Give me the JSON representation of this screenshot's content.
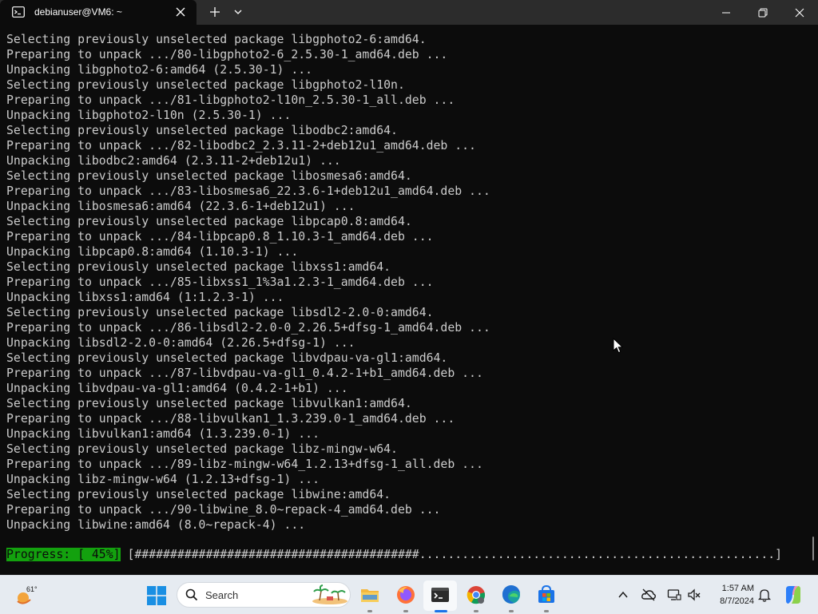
{
  "window": {
    "tab_title": "debianuser@VM6: ~",
    "icons": {
      "tab": "terminal-icon",
      "close_tab": "close-icon",
      "new_tab": "plus-icon",
      "tab_menu": "chevron-down-icon"
    }
  },
  "terminal": {
    "lines": [
      "Selecting previously unselected package libgphoto2-6:amd64.",
      "Preparing to unpack .../80-libgphoto2-6_2.5.30-1_amd64.deb ...",
      "Unpacking libgphoto2-6:amd64 (2.5.30-1) ...",
      "Selecting previously unselected package libgphoto2-l10n.",
      "Preparing to unpack .../81-libgphoto2-l10n_2.5.30-1_all.deb ...",
      "Unpacking libgphoto2-l10n (2.5.30-1) ...",
      "Selecting previously unselected package libodbc2:amd64.",
      "Preparing to unpack .../82-libodbc2_2.3.11-2+deb12u1_amd64.deb ...",
      "Unpacking libodbc2:amd64 (2.3.11-2+deb12u1) ...",
      "Selecting previously unselected package libosmesa6:amd64.",
      "Preparing to unpack .../83-libosmesa6_22.3.6-1+deb12u1_amd64.deb ...",
      "Unpacking libosmesa6:amd64 (22.3.6-1+deb12u1) ...",
      "Selecting previously unselected package libpcap0.8:amd64.",
      "Preparing to unpack .../84-libpcap0.8_1.10.3-1_amd64.deb ...",
      "Unpacking libpcap0.8:amd64 (1.10.3-1) ...",
      "Selecting previously unselected package libxss1:amd64.",
      "Preparing to unpack .../85-libxss1_1%3a1.2.3-1_amd64.deb ...",
      "Unpacking libxss1:amd64 (1:1.2.3-1) ...",
      "Selecting previously unselected package libsdl2-2.0-0:amd64.",
      "Preparing to unpack .../86-libsdl2-2.0-0_2.26.5+dfsg-1_amd64.deb ...",
      "Unpacking libsdl2-2.0-0:amd64 (2.26.5+dfsg-1) ...",
      "Selecting previously unselected package libvdpau-va-gl1:amd64.",
      "Preparing to unpack .../87-libvdpau-va-gl1_0.4.2-1+b1_amd64.deb ...",
      "Unpacking libvdpau-va-gl1:amd64 (0.4.2-1+b1) ...",
      "Selecting previously unselected package libvulkan1:amd64.",
      "Preparing to unpack .../88-libvulkan1_1.3.239.0-1_amd64.deb ...",
      "Unpacking libvulkan1:amd64 (1.3.239.0-1) ...",
      "Selecting previously unselected package libz-mingw-w64.",
      "Preparing to unpack .../89-libz-mingw-w64_1.2.13+dfsg-1_all.deb ...",
      "Unpacking libz-mingw-w64 (1.2.13+dfsg-1) ...",
      "Selecting previously unselected package libwine:amd64.",
      "Preparing to unpack .../90-libwine_8.0~repack-4_amd64.deb ...",
      "Unpacking libwine:amd64 (8.0~repack-4) ..."
    ],
    "progress": {
      "label": "Progress: [ 45%]",
      "bar": "[########################################..................................................]",
      "percent": 45
    },
    "colors": {
      "background": "#0c0c0c",
      "text": "#cccccc",
      "progress_highlight": "#13a10e"
    }
  },
  "taskbar": {
    "weather": {
      "temp": "61°",
      "icon": "weather-sun-icon"
    },
    "search_placeholder": "Search",
    "apps": [
      {
        "name": "File Explorer",
        "icon": "folder-icon"
      },
      {
        "name": "Firefox",
        "icon": "firefox-icon"
      },
      {
        "name": "Terminal",
        "icon": "terminal-icon",
        "active": true
      },
      {
        "name": "Chrome",
        "icon": "chrome-icon"
      },
      {
        "name": "Edge",
        "icon": "edge-icon"
      },
      {
        "name": "Microsoft Store",
        "icon": "store-icon"
      }
    ],
    "clock": {
      "time": "1:57 AM",
      "date": "8/7/2024"
    }
  }
}
